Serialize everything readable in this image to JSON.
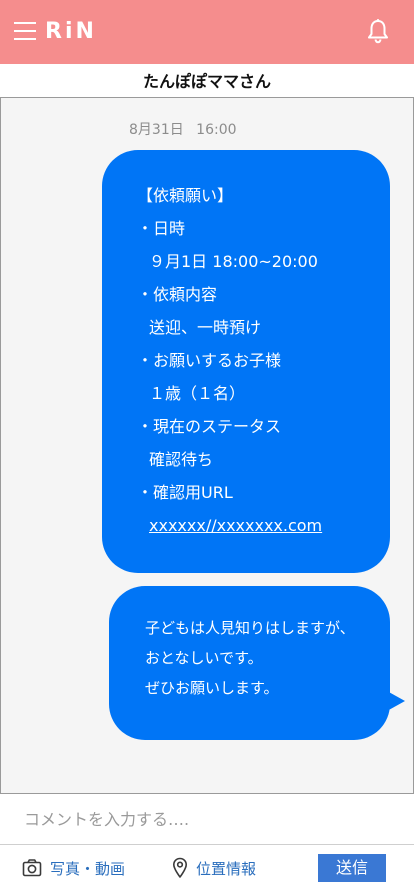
{
  "header": {
    "logo_text": "RiN",
    "menu_icon": "hamburger-menu-icon",
    "bell_icon": "bell-icon",
    "background_color": "#f58d8d"
  },
  "chat": {
    "partner_name": "たんぽぽママさん",
    "timestamp": "8月31日 16:00",
    "messages": [
      {
        "lines": [
          "【依頼願い】",
          "・日時",
          "９月1日 18:00~20:00",
          "・依頼内容",
          "送迎、一時預け",
          "・お願いするお子様",
          "１歳（１名）",
          "・現在のステータス",
          "確認待ち",
          "・確認用URL",
          "xxxxxx//xxxxxxx.com"
        ]
      },
      {
        "lines": [
          "子どもは人見知りはしますが、",
          "おとなしいです。",
          "ぜひお願いします。"
        ]
      }
    ],
    "bubble_color": "#0075f6"
  },
  "composer": {
    "placeholder": "コメントを入力する….",
    "photo_label": "写真・動画",
    "location_label": "位置情報",
    "send_label": "送信",
    "camera_icon": "camera-icon",
    "location_icon": "location-pin-icon",
    "accent_color": "#3a78d4"
  }
}
